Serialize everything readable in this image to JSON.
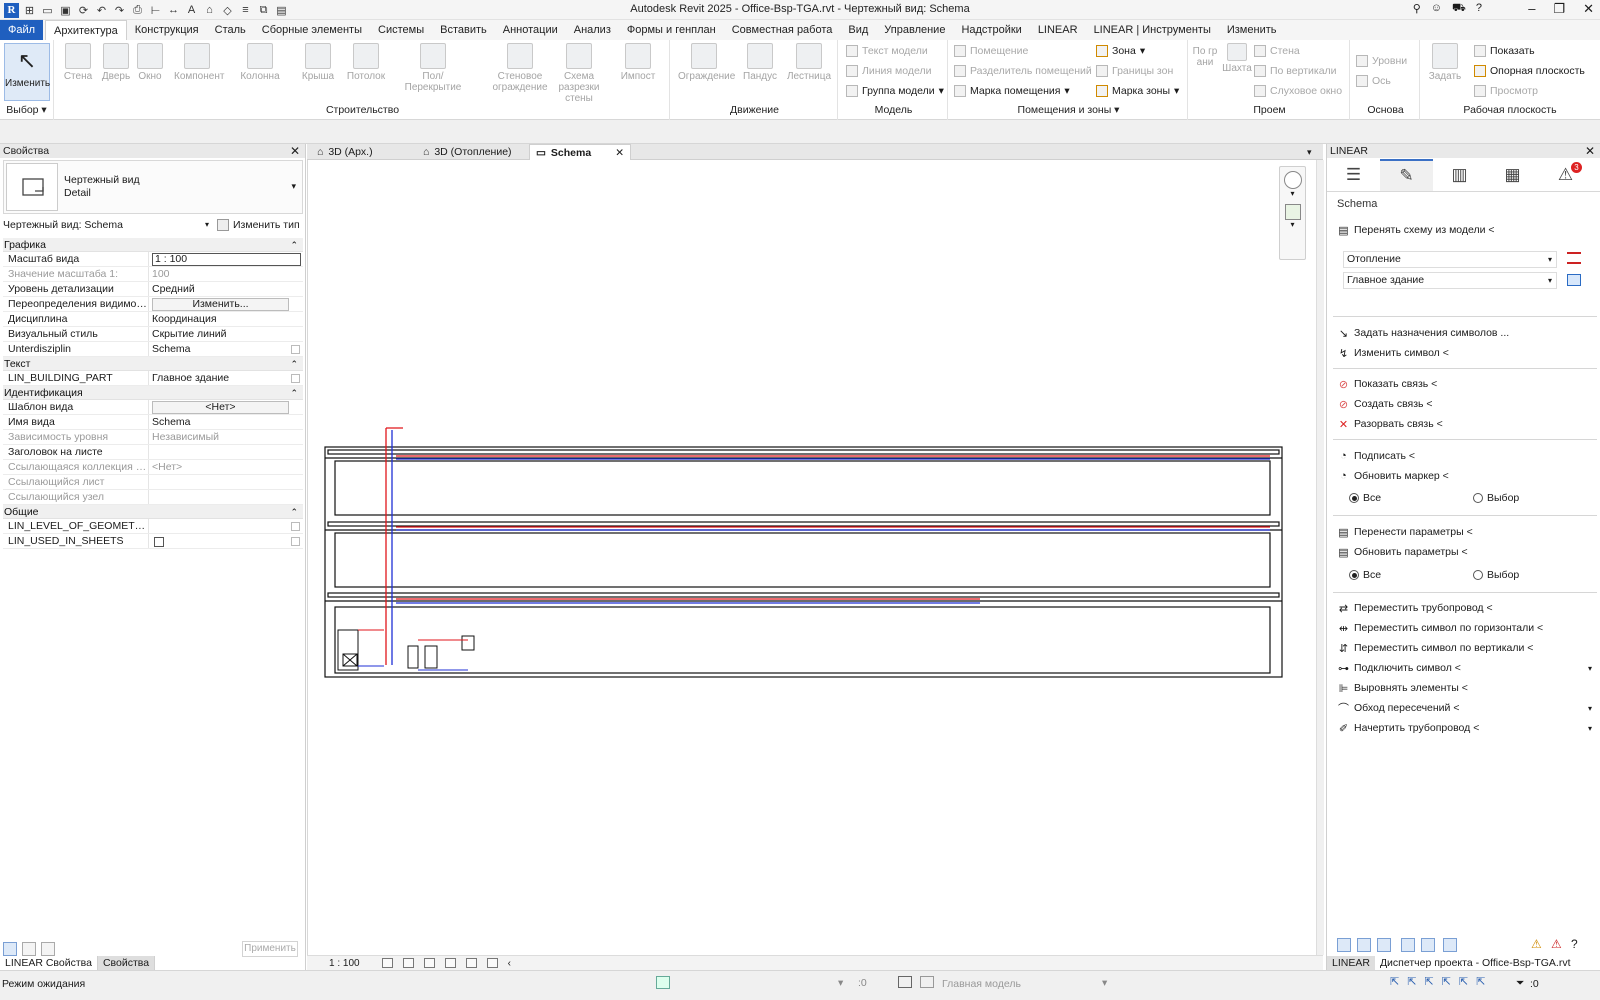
{
  "app": {
    "title": "Autodesk Revit 2025 - Office-Bsp-TGA.rvt - Чертежный вид: Schema"
  },
  "ribbon": {
    "tabs": [
      "Файл",
      "Архитектура",
      "Конструкция",
      "Сталь",
      "Сборные элементы",
      "Системы",
      "Вставить",
      "Аннотации",
      "Анализ",
      "Формы и генплан",
      "Совместная работа",
      "Вид",
      "Управление",
      "Надстройки",
      "LINEAR",
      "LINEAR | Инструменты",
      "Изменить"
    ],
    "active_tab": "Архитектура",
    "select": {
      "modify": "Изменить",
      "panel": "Выбор"
    },
    "build": {
      "panel": "Строительство",
      "tools": [
        "Стена",
        "Дверь",
        "Окно",
        "Компонент",
        "Колонна",
        "Крыша",
        "Потолок",
        "Пол/Перекрытие",
        "Стеновое ограждение",
        "Схема разрезки стены",
        "Импост"
      ]
    },
    "circulation": {
      "panel": "Движение",
      "tools": [
        "Ограждение",
        "Пандус",
        "Лестница"
      ]
    },
    "model": {
      "panel": "Модель",
      "text": "Текст модели",
      "line": "Линия модели",
      "group": "Группа модели"
    },
    "rooms": {
      "panel": "Помещения и зоны",
      "room": "Помещение",
      "separator": "Разделитель помещений",
      "tag": "Марка помещения",
      "area": "Зона",
      "area_boundary": "Границы зон",
      "area_tag": "Марка зоны"
    },
    "opening": {
      "panel": "Проем",
      "by_face": "По грани",
      "shaft": "Шахта",
      "wall": "Стена",
      "vertical": "По вертикали",
      "dormer": "Слуховое окно"
    },
    "datum": {
      "panel": "Основа",
      "level": "Уровни",
      "grid": "Ось"
    },
    "workplane": {
      "panel": "Рабочая плоскость",
      "set": "Задать",
      "show": "Показать",
      "ref_plane": "Опорная плоскость",
      "viewer": "Просмотр"
    }
  },
  "properties": {
    "header": "Свойства",
    "type_line1": "Чертежный вид",
    "type_line2": "Detail",
    "view_selector": "Чертежный вид: Schema",
    "edit_type": "Изменить тип",
    "sections": {
      "graphics": "Графика",
      "text": "Текст",
      "identity": "Идентификация",
      "general": "Общие"
    },
    "rows": {
      "scale": [
        "Масштаб вида",
        "1 : 100"
      ],
      "scale_value": [
        "Значение масштаба    1:",
        "100"
      ],
      "detail": [
        "Уровень детализации",
        "Средний"
      ],
      "visibility": [
        "Переопределения видимост...",
        "Изменить..."
      ],
      "discipline": [
        "Дисциплина",
        "Координация"
      ],
      "visual_style": [
        "Визуальный стиль",
        "Скрытие линий"
      ],
      "subdiscipline": [
        "Unterdisziplin",
        "Schema"
      ],
      "building_part": [
        "LIN_BUILDING_PART",
        "Главное здание"
      ],
      "template": [
        "Шаблон вида",
        "<Нет>"
      ],
      "view_name": [
        "Имя вида",
        "Schema"
      ],
      "dependency": [
        "Зависимость уровня",
        "Независимый"
      ],
      "title_on_sheet": [
        "Заголовок на листе",
        ""
      ],
      "ref_collection": [
        "Ссылающаяся коллекция л...",
        "<Нет>"
      ],
      "ref_sheet": [
        "Ссылающийся лист",
        ""
      ],
      "ref_detail": [
        "Ссылающийся узел",
        ""
      ],
      "lod": [
        "LIN_LEVEL_OF_GEOMETRY",
        ""
      ],
      "used_in_sheets": [
        "LIN_USED_IN_SHEETS",
        ""
      ]
    },
    "apply": "Применить",
    "tabs": [
      "LINEAR Свойства",
      "Свойства"
    ]
  },
  "views": {
    "tabs": [
      "3D (Арх.)",
      "3D (Отопление)",
      "Schema"
    ],
    "active": "Schema",
    "scale": "1 : 100"
  },
  "linear": {
    "header": "LINEAR",
    "badge": "3",
    "section": "Schema",
    "transfer": "Перенять схему из модели <",
    "system": "Отопление",
    "building": "Главное здание",
    "assign_symbols": "Задать назначения символов ...",
    "change_symbol": "Изменить символ <",
    "show_link": "Показать связь <",
    "create_link": "Создать связь <",
    "break_link": "Разорвать связь <",
    "sign": "Подписать <",
    "update_marker": "Обновить маркер <",
    "radio_all": "Все",
    "radio_select": "Выбор",
    "transfer_params": "Перенести параметры <",
    "update_params": "Обновить параметры <",
    "move_pipe": "Переместить трубопровод <",
    "move_sym_h": "Переместить символ по горизонтали <",
    "move_sym_v": "Переместить символ по вертикали <",
    "connect_symbol": "Подключить символ <",
    "align": "Выровнять элементы <",
    "bypass": "Обход пересечений <",
    "draw_pipe": "Начертить трубопровод <",
    "tabs": [
      "LINEAR",
      "Диспетчер проекта - Office-Bsp-TGA.rvt"
    ]
  },
  "status": {
    "text": "Режим ожидания",
    "count": ":0",
    "model": "Главная модель",
    "filter": ":0"
  },
  "colors": {
    "accent": "#1f5fbf",
    "supply": "#e0161b",
    "return": "#1f2fd6"
  }
}
